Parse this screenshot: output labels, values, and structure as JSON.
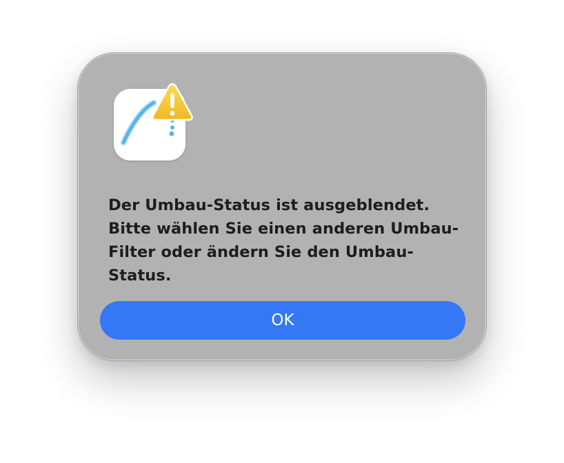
{
  "dialog": {
    "message": "Der Umbau-Status ist ausgeblendet. Bitte wählen Sie einen anderen Umbau-Filter oder ändern Sie den Umbau-Status.",
    "icon": "app-icon-with-warning",
    "ok_label": "OK"
  },
  "colors": {
    "dialog_background": "#b2b2b2",
    "button_accent": "#3478f6",
    "warning_yellow": "#f5c530",
    "icon_stroke_blue": "#5ab4e6"
  }
}
